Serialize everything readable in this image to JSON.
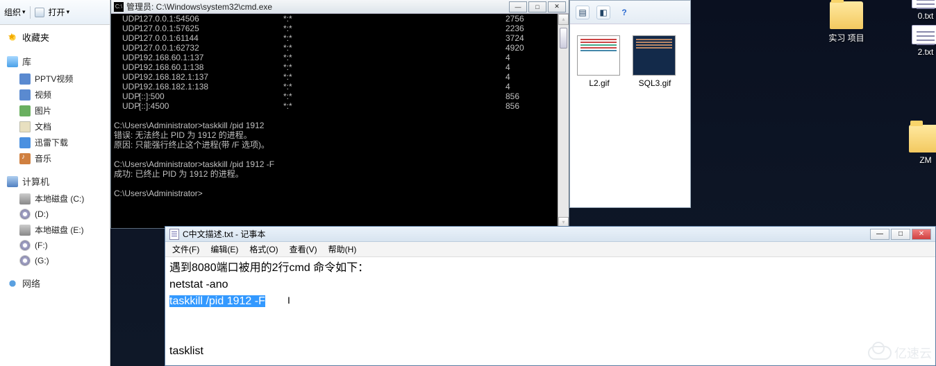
{
  "explorer_left": {
    "toolbar": {
      "organize": "组织",
      "open": "打开"
    },
    "favorites": {
      "label": "收藏夹"
    },
    "library": {
      "label": "库",
      "items": [
        "PPTV视频",
        "视频",
        "图片",
        "文档",
        "迅雷下载",
        "音乐"
      ]
    },
    "computer": {
      "label": "计算机",
      "items": [
        "本地磁盘 (C:)",
        "(D:)",
        "本地磁盘 (E:)",
        "(F:)",
        "(G:)"
      ]
    },
    "network": {
      "label": "网络"
    }
  },
  "cmd": {
    "title": "管理员: C:\\Windows\\system32\\cmd.exe",
    "netstat": [
      {
        "proto": "UDP",
        "local": "127.0.0.1:54506",
        "foreign": "*:*",
        "pid": "2756"
      },
      {
        "proto": "UDP",
        "local": "127.0.0.1:57625",
        "foreign": "*:*",
        "pid": "2236"
      },
      {
        "proto": "UDP",
        "local": "127.0.0.1:61144",
        "foreign": "*:*",
        "pid": "3724"
      },
      {
        "proto": "UDP",
        "local": "127.0.0.1:62732",
        "foreign": "*:*",
        "pid": "4920"
      },
      {
        "proto": "UDP",
        "local": "192.168.60.1:137",
        "foreign": "*:*",
        "pid": "4"
      },
      {
        "proto": "UDP",
        "local": "192.168.60.1:138",
        "foreign": "*:*",
        "pid": "4"
      },
      {
        "proto": "UDP",
        "local": "192.168.182.1:137",
        "foreign": "*:*",
        "pid": "4"
      },
      {
        "proto": "UDP",
        "local": "192.168.182.1:138",
        "foreign": "*:*",
        "pid": "4"
      },
      {
        "proto": "UDP",
        "local": "[::]:500",
        "foreign": "*:*",
        "pid": "856"
      },
      {
        "proto": "UDP",
        "local": "[::]:4500",
        "foreign": "*:*",
        "pid": "856"
      }
    ],
    "lines": [
      "",
      "C:\\Users\\Administrator>taskkill /pid 1912",
      "错误: 无法终止 PID 为 1912 的进程。",
      "原因: 只能强行终止这个进程(带 /F 选项)。",
      "",
      "C:\\Users\\Administrator>taskkill /pid 1912 -F",
      "成功: 已终止 PID 为 1912 的进程。",
      "",
      "C:\\Users\\Administrator>"
    ]
  },
  "explorer_right": {
    "files": [
      "L2.gif",
      "SQL3.gif"
    ]
  },
  "desktop": {
    "folder1": "实习 项目",
    "txt0": "0.txt",
    "txt2": "2.txt",
    "zm": "ZM"
  },
  "notepad": {
    "title": "C中文描述.txt - 记事本",
    "menu": [
      "文件(F)",
      "编辑(E)",
      "格式(O)",
      "查看(V)",
      "帮助(H)"
    ],
    "line1": "遇到8080端口被用的2行cmd 命令如下：",
    "line2": " netstat -ano",
    "line3_sel": "taskkill /pid  1912 -F",
    "line5": "tasklist"
  },
  "watermark": "亿速云"
}
